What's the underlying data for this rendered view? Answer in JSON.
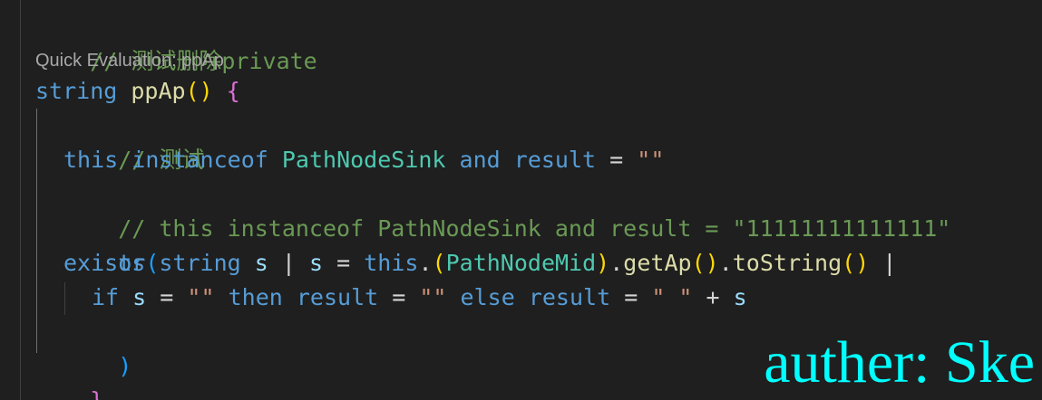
{
  "code_lens": "Quick Evaluation: ppAp",
  "watermark": "auther: Ske",
  "lines": {
    "l1": {
      "comment": "// 测试删除private"
    },
    "l2": {
      "kw": "string",
      "fn": "ppAp",
      "p1": "(",
      "p2": ")",
      "brace": "{"
    },
    "l3": {
      "comment": "// 测试"
    },
    "l4": {
      "this": "this",
      "instanceof": "instanceof",
      "type": "PathNodeSink",
      "and": "and",
      "result": "result",
      "eq": "=",
      "str": "\"\""
    },
    "l5": {
      "comment": "// this instanceof PathNodeSink and result = \"11111111111111\""
    },
    "l6": {
      "or": "or"
    },
    "l7": {
      "exists": "exists",
      "p1": "(",
      "string": "string",
      "s1": "s",
      "bar1": "|",
      "s2": "s",
      "eq": "=",
      "this": "this",
      "dot1": ".",
      "cp1": "(",
      "type": "PathNodeMid",
      "cp2": ")",
      "dot2": ".",
      "getAp": "getAp",
      "gp1": "(",
      "gp2": ")",
      "dot3": ".",
      "toString": "toString",
      "tp1": "(",
      "tp2": ")",
      "bar2": "|"
    },
    "l8": {
      "if": "if",
      "s1": "s",
      "eq1": "=",
      "str1": "\"\"",
      "then": "then",
      "result1": "result",
      "eq2": "=",
      "str2": "\"\"",
      "else": "else",
      "result2": "result",
      "eq3": "=",
      "str3": "\" \"",
      "plus": "+",
      "s2": "s"
    },
    "l9": {
      "p": ")"
    },
    "l10": {
      "brace": "}"
    }
  },
  "colors": {
    "background": "#1f1f1f",
    "comment": "#6a9955",
    "keyword": "#569cd6",
    "type": "#4ec9b0",
    "function": "#dcdcaa",
    "variable": "#9cdcfe",
    "string": "#ce9178",
    "watermark": "#00ffff"
  }
}
